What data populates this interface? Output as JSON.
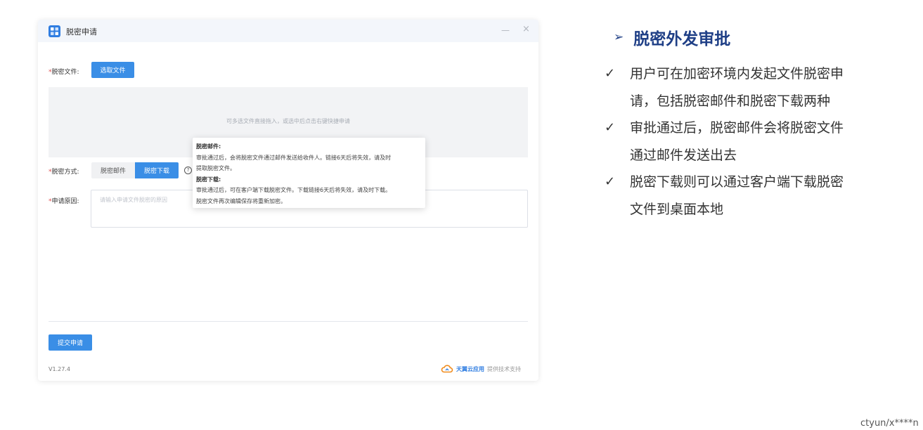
{
  "window": {
    "title": "脱密申请",
    "minimize_glyph": "—",
    "close_glyph": "×"
  },
  "form": {
    "file": {
      "required_mark": "*",
      "label": "脱密文件:",
      "select_button": "选取文件"
    },
    "dropzone_hint": "可多选文件直接拖入，或选中后点击右键快捷申请",
    "method": {
      "required_mark": "*",
      "label": "脱密方式:",
      "options": [
        "脱密邮件",
        "脱密下载"
      ],
      "selected": "脱密下载",
      "help_glyph": "?"
    },
    "reason": {
      "required_mark": "*",
      "label": "申请原因:",
      "placeholder": "请输入申请文件脱密的原因",
      "value": ""
    },
    "submit_button": "提交申请"
  },
  "tooltip": {
    "mail_title": "脱密邮件:",
    "mail_line1": "审批通过后，会将脱密文件通过邮件发送给收件人。链接6天后将失效，请及时",
    "mail_line2": "提取脱密文件。",
    "download_title": "脱密下载:",
    "download_line1": "审批通过后，可在客户端下载脱密文件。下载链接6天后将失效，请及时下载。",
    "download_line2": "脱密文件再次编辑保存将重新加密。"
  },
  "footer": {
    "version": "V1.27.4",
    "brand_icon": "cloud-icon",
    "brand_name": "天翼云应用",
    "support_text": "提供技术支持"
  },
  "description": {
    "heading_arrow": "➢",
    "heading": "脱密外发审批",
    "check_glyph": "✓",
    "bullets": [
      {
        "line1": "用户可在加密环境内发起文件脱密申",
        "line2": "请，包括脱密邮件和脱密下载两种"
      },
      {
        "line1": "审批通过后，脱密邮件会将脱密文件",
        "line2": "通过邮件发送出去"
      },
      {
        "line1": "脱密下载则可以通过客户端下载脱密",
        "line2": "文件到桌面本地"
      }
    ]
  },
  "watermark": "ctyun/x****n",
  "colors": {
    "primary": "#3a8ee6",
    "heading": "#1f3f86",
    "required": "#e24a4a",
    "brand_orange": "#f08c1e"
  }
}
